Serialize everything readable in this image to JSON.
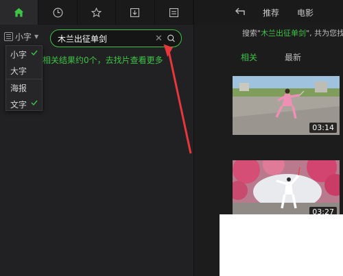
{
  "left": {
    "tabs": [
      {
        "icon": "home-icon",
        "active": true
      },
      {
        "icon": "clock-icon",
        "active": false
      },
      {
        "icon": "star-icon",
        "active": false
      },
      {
        "icon": "download-icon",
        "active": false
      },
      {
        "icon": "list-icon",
        "active": false
      }
    ],
    "size_select": {
      "label": "小字"
    },
    "search": {
      "value": "木兰出征单剑"
    },
    "dropdown": {
      "items": [
        {
          "label": "小字",
          "checked": true
        },
        {
          "label": "大字",
          "checked": false
        },
        {
          "label": "海报",
          "checked": false
        },
        {
          "label": "文字",
          "checked": true
        }
      ]
    },
    "result_message": "相关结果约0个，去找片查看更多"
  },
  "right": {
    "nav": {
      "items": [
        "推荐",
        "电影"
      ]
    },
    "info": {
      "prefix": "搜索\"",
      "keyword": "木兰出征单剑",
      "suffix": "\", 共为您找"
    },
    "sub_tabs": [
      {
        "label": "相关",
        "active": true
      },
      {
        "label": "最新",
        "active": false
      }
    ],
    "videos": [
      {
        "duration": "03:14"
      },
      {
        "duration": "03:27"
      }
    ]
  },
  "colors": {
    "accent": "#3ec446",
    "annotation": "#e8373b"
  }
}
